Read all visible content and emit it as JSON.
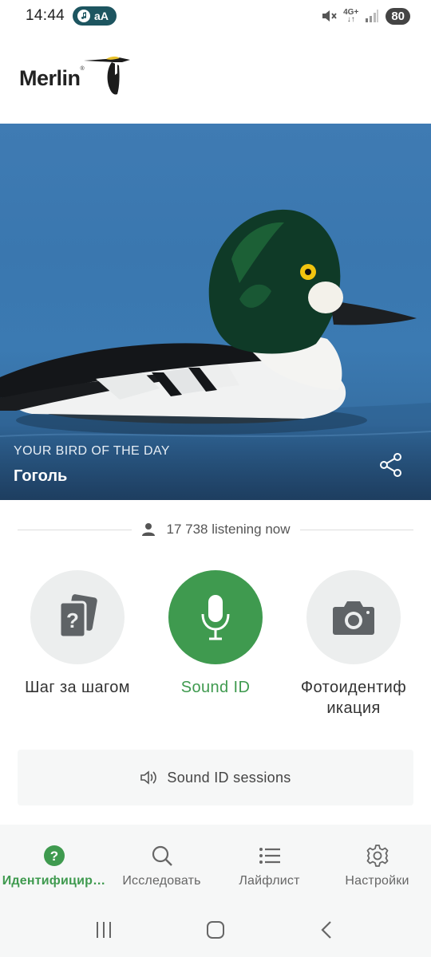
{
  "status_bar": {
    "time": "14:44",
    "pill_text": "aA",
    "network": "4G+",
    "battery": "80"
  },
  "header": {
    "logo_text": "Merlin",
    "logo_mark": "®"
  },
  "hero": {
    "kicker": "YOUR BIRD OF THE DAY",
    "bird_name": "Гоголь"
  },
  "listening": {
    "text": "17 738 listening now"
  },
  "id_options": {
    "step_by_step": "Шаг за шагом",
    "sound_id": "Sound ID",
    "photo_id_line1": "Фотоидентиф",
    "photo_id_line2": "икация"
  },
  "sessions": {
    "label": "Sound ID sessions"
  },
  "bottom_nav": {
    "identify": "Идентифицир…",
    "explore": "Исследовать",
    "lifelist": "Лайфлист",
    "settings": "Настройки"
  },
  "colors": {
    "accent": "#3f9a4f",
    "pill": "#1d5560",
    "water": "#3b7ab2"
  }
}
